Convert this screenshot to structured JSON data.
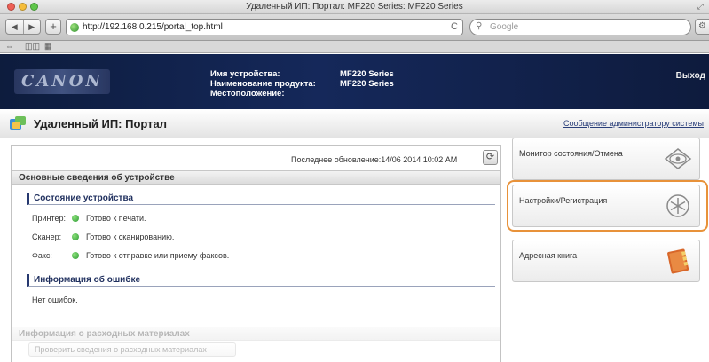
{
  "browser": {
    "window_title": "Удаленный ИП: Портал: MF220 Series: MF220 Series",
    "url": "http://192.168.0.215/portal_top.html",
    "search_placeholder": "Google",
    "reload_glyph": "C",
    "resize_glyph": "⤢",
    "nav_back": "◀",
    "nav_forward": "▶",
    "add_glyph": "+",
    "bookmark_items": [
      "⇔",
      "◫◫",
      "▦"
    ]
  },
  "header": {
    "logo_text": "CANON",
    "device_name_label": "Имя устройства:",
    "device_name_value": "MF220 Series",
    "product_name_label": "Наименование продукта:",
    "product_name_value": "MF220 Series",
    "location_label": "Местоположение:",
    "location_value": "",
    "logout_label": "Выход"
  },
  "portal": {
    "title": "Удаленный ИП: Портал",
    "admin_message_link": "Сообщение администратору системы"
  },
  "main": {
    "last_update": "Последнее обновление:14/06 2014 10:02 AM",
    "refresh_glyph": "⟳",
    "basic_info_heading": "Основные сведения об устройстве",
    "device_status_heading": "Состояние устройства",
    "statuses": [
      {
        "label": "Принтер:",
        "value": "Готово к печати."
      },
      {
        "label": "Сканер:",
        "value": "Готово к сканированию."
      },
      {
        "label": "Факс:",
        "value": "Готово к отправке или приему факсов."
      }
    ],
    "error_info_heading": "Информация об ошибке",
    "error_info_value": "Нет ошибок.",
    "consumables_heading": "Информация о расходных материалах",
    "consumables_button": "Проверить сведения о расходных материалах"
  },
  "sidebar": {
    "items": [
      {
        "label": "Монитор состояния/Отмена",
        "icon": "eye-icon"
      },
      {
        "label": "Настройки/Регистрация",
        "icon": "settings-asterisk-icon"
      },
      {
        "label": "Адресная книга",
        "icon": "address-book-icon"
      }
    ]
  },
  "colors": {
    "header_bg": "#15285a",
    "status_ok": "#2e9b35",
    "highlight": "#e8923a",
    "section_accent": "#26386f"
  }
}
